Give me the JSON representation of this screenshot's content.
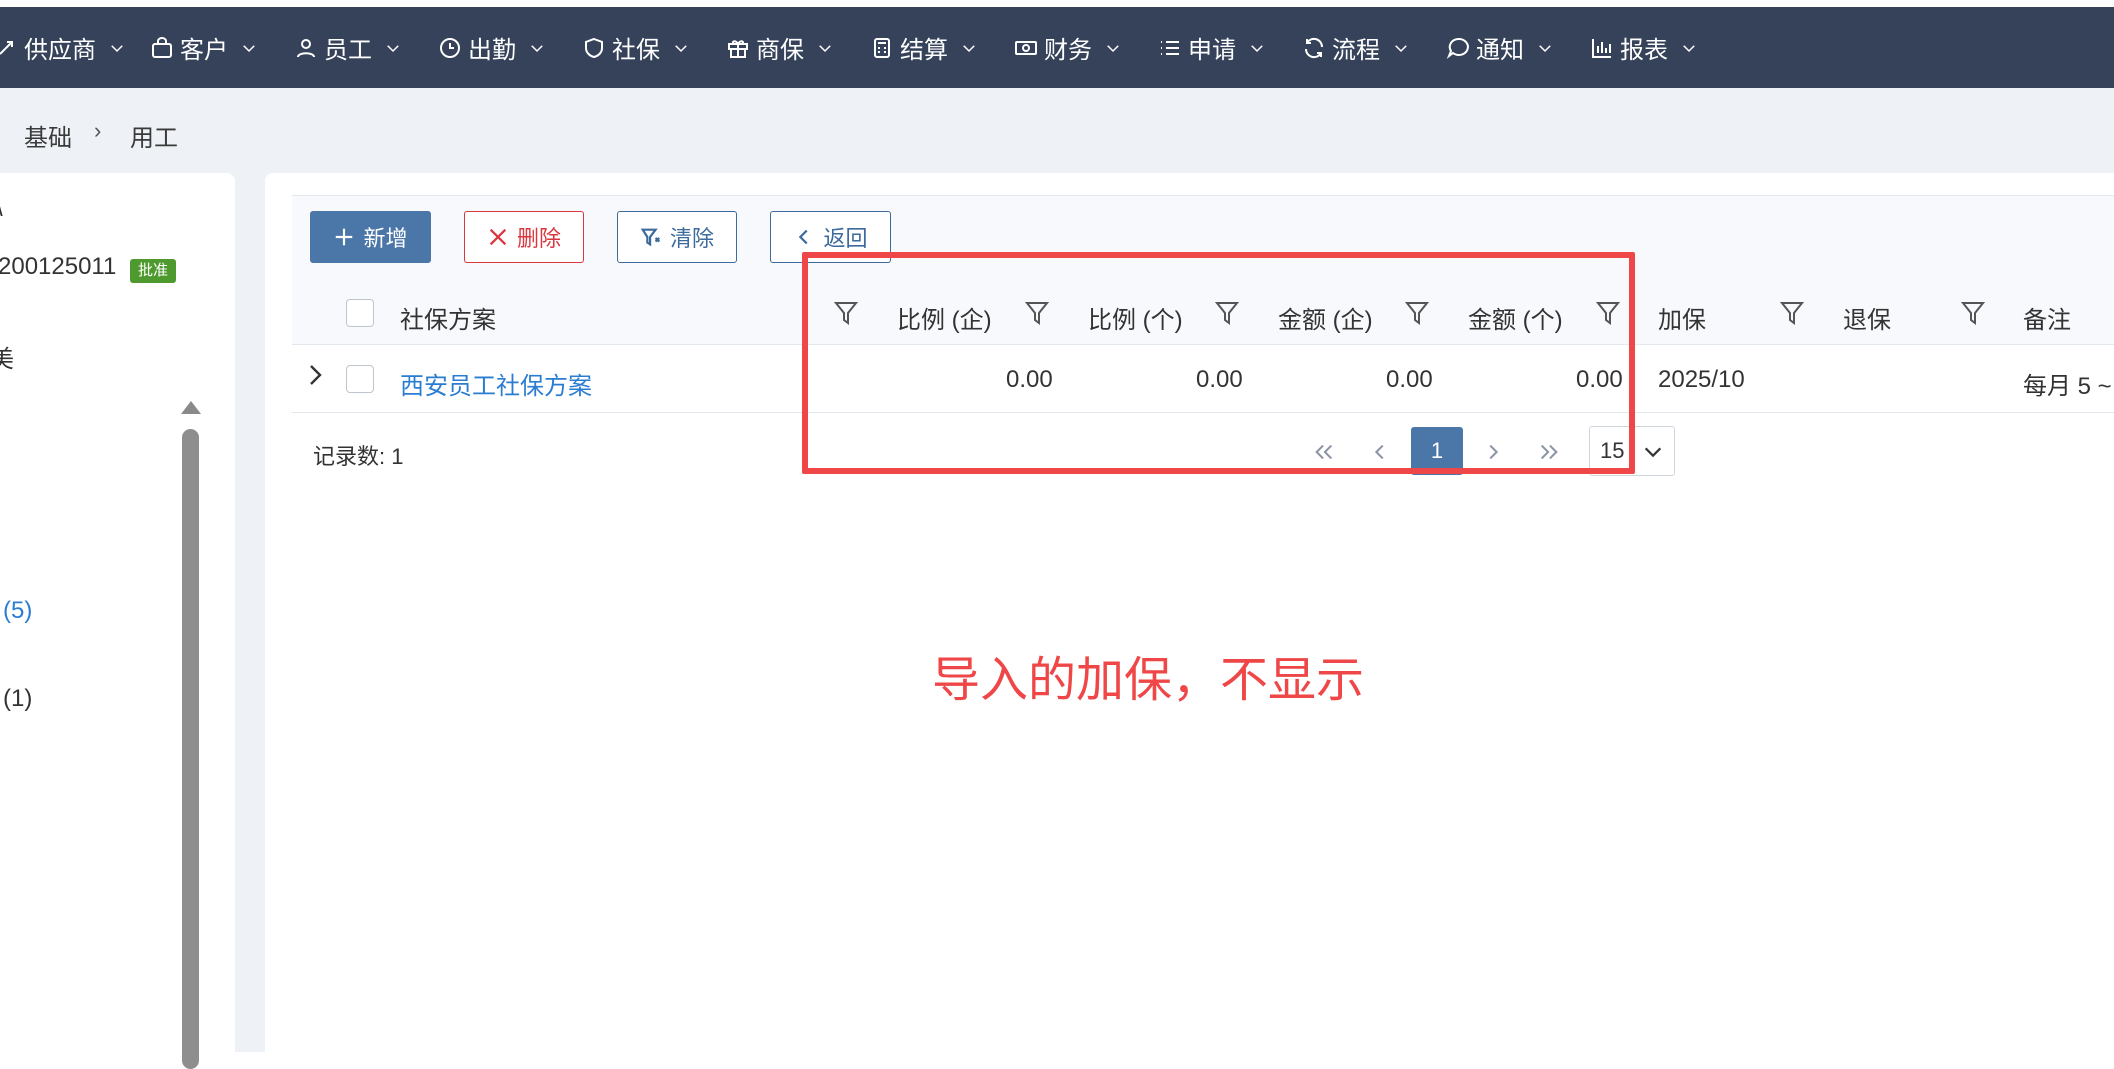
{
  "nav": {
    "items": [
      {
        "label": "供应商",
        "icon": "supplier-icon"
      },
      {
        "label": "客户",
        "icon": "bag-icon"
      },
      {
        "label": "员工",
        "icon": "user-icon"
      },
      {
        "label": "出勤",
        "icon": "clock-icon"
      },
      {
        "label": "社保",
        "icon": "shield-icon"
      },
      {
        "label": "商保",
        "icon": "gift-icon"
      },
      {
        "label": "结算",
        "icon": "calculator-icon"
      },
      {
        "label": "财务",
        "icon": "money-icon"
      },
      {
        "label": "申请",
        "icon": "list-icon"
      },
      {
        "label": "流程",
        "icon": "refresh-icon"
      },
      {
        "label": "通知",
        "icon": "chat-icon"
      },
      {
        "label": "报表",
        "icon": "bar-chart-icon"
      }
    ]
  },
  "breadcrumb": {
    "items": [
      "基础",
      "用工"
    ]
  },
  "left_panel": {
    "line1": "\\",
    "code": "200125011",
    "badge": "批准",
    "line3": "美",
    "count1": "(5)",
    "count2": "(1)"
  },
  "toolbar": {
    "add_label": "新增",
    "delete_label": "删除",
    "clear_label": "清除",
    "back_label": "返回"
  },
  "table": {
    "headers": [
      "社保方案",
      "比例 (企)",
      "比例 (个)",
      "金额 (企)",
      "金额 (个)",
      "加保",
      "退保",
      "备注"
    ],
    "rows": [
      {
        "plan": "西安员工社保方案",
        "ratio_company": "0.00",
        "ratio_personal": "0.00",
        "amount_company": "0.00",
        "amount_personal": "0.00",
        "add_insurance": "2025/10",
        "remove_insurance": "",
        "note": "每月 5 ~"
      }
    ]
  },
  "footer": {
    "records_label": "记录数: 1",
    "current_page": "1",
    "page_size": "15"
  },
  "annotation": {
    "text": "导入的加保，不显示",
    "color": "#ef4747"
  },
  "colors": {
    "navbar": "#354259",
    "primary": "#4a76a8",
    "danger": "#d9363e",
    "link": "#2a7dd1",
    "badge": "#4f9a2f"
  }
}
